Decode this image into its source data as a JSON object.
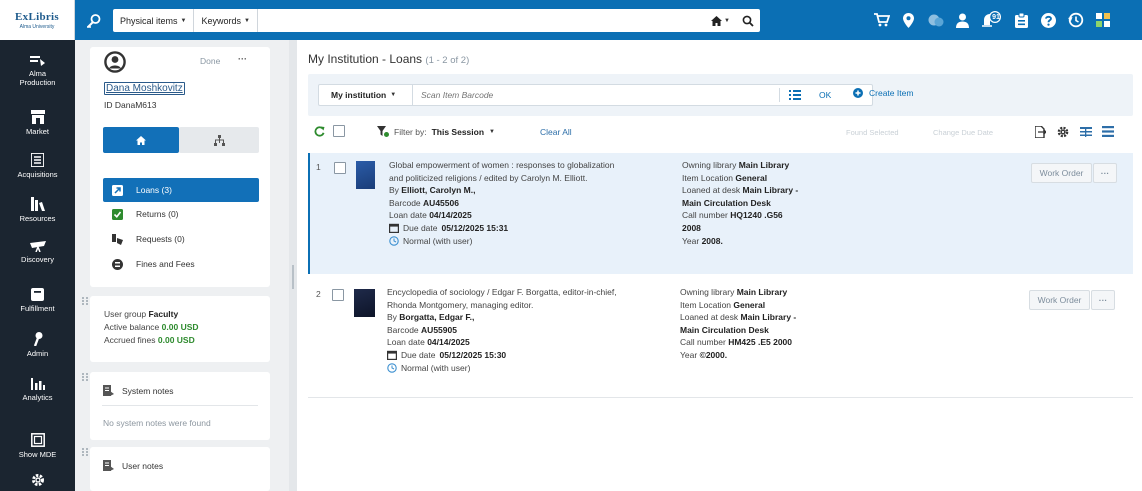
{
  "logo": {
    "line1": "ExLibris",
    "line2": "Alma University"
  },
  "search": {
    "type": "Physical items",
    "field": "Keywords",
    "scope_icon": "home-icon"
  },
  "top_icons": [
    "cart-icon",
    "location-pin-icon",
    "tasks-icon",
    "user-icon",
    "notifications-icon",
    "clipboard-icon",
    "help-icon",
    "history-icon",
    "apps-icon"
  ],
  "notification_count": "91",
  "nav": [
    {
      "label": "Alma\nProduction",
      "icon": "alma-icon"
    },
    {
      "label": "Market",
      "icon": "market-icon"
    },
    {
      "label": "Acquisitions",
      "icon": "acquisitions-icon"
    },
    {
      "label": "Resources",
      "icon": "resources-icon"
    },
    {
      "label": "Discovery",
      "icon": "discovery-icon"
    },
    {
      "label": "Fulfillment",
      "icon": "fulfillment-icon"
    },
    {
      "label": "Admin",
      "icon": "admin-icon"
    },
    {
      "label": "Analytics",
      "icon": "analytics-icon"
    },
    {
      "label": "Show MDE",
      "icon": "mde-icon"
    },
    {
      "label": "",
      "icon": "settings-icon"
    }
  ],
  "user": {
    "done_label": "Done",
    "more": "···",
    "name": "Dana Moshkovitz",
    "id_label": "ID",
    "id_value": "DanaM613",
    "menu": [
      {
        "label": "Loans (3)",
        "icon": "loans-icon",
        "active": true
      },
      {
        "label": "Returns (0)",
        "icon": "returns-icon",
        "active": false
      },
      {
        "label": "Requests (0)",
        "icon": "requests-icon",
        "active": false
      },
      {
        "label": "Fines and Fees",
        "icon": "fines-icon",
        "active": false
      }
    ],
    "group_label": "User group",
    "group_value": "Faculty",
    "balance_label": "Active balance",
    "balance_value": "0.00 USD",
    "accrued_label": "Accrued fines",
    "accrued_value": "0.00 USD",
    "system_notes_title": "System notes",
    "system_notes_empty": "No system notes were found",
    "user_notes_title": "User notes"
  },
  "main": {
    "title": "My Institution - Loans",
    "count": "(1 - 2 of 2)",
    "scope": "My institution",
    "scan_placeholder": "Scan Item Barcode",
    "ok": "OK",
    "create_item": "Create Item",
    "filter_label": "Filter by:",
    "filter_value": "This Session",
    "clear_all": "Clear All",
    "found_selected": "Found Selected",
    "change_due_date": "Change Due Date",
    "colors": {
      "accent": "#0b6fb4",
      "green": "#2e8b2e",
      "selected_row": "#e8f1fa"
    }
  },
  "loans": [
    {
      "index": "1",
      "title_line1": "Global empowerment of women : responses to globalization",
      "title_line2": "and politicized religions / edited by Carolyn M. Elliott.",
      "author_label": "By",
      "author": "Elliott, Carolyn M.,",
      "barcode_label": "Barcode",
      "barcode": "AU45506",
      "loan_label": "Loan date",
      "loan_date": "04/14/2025",
      "due_label": "Due date",
      "due_date": "05/12/2025 15:31",
      "status": "Normal (with user)",
      "owning_label": "Owning library",
      "owning": "Main Library",
      "location_label": "Item Location",
      "location": "General",
      "desk_label": "Loaned at desk",
      "desk_a": "Main Library -",
      "desk_b": "Main Circulation Desk",
      "call_label": "Call number",
      "call_a": "HQ1240 .G56",
      "call_b": "2008",
      "year_label": "Year",
      "year": "2008.",
      "action": "Work Order",
      "more": "···"
    },
    {
      "index": "2",
      "title_line1": "Encyclopedia of sociology / Edgar F. Borgatta, editor-in-chief,",
      "title_line2": "Rhonda Montgomery, managing editor.",
      "author_label": "By",
      "author": "Borgatta, Edgar F.,",
      "barcode_label": "Barcode",
      "barcode": "AU55905",
      "loan_label": "Loan date",
      "loan_date": "04/14/2025",
      "due_label": "Due date",
      "due_date": "05/12/2025 15:30",
      "status": "Normal (with user)",
      "owning_label": "Owning library",
      "owning": "Main Library",
      "location_label": "Item Location",
      "location": "General",
      "desk_label": "Loaned at desk",
      "desk_a": "Main Library -",
      "desk_b": "Main Circulation Desk",
      "call_label": "Call number",
      "call_a": "HM425 .E5 2000",
      "call_b": "",
      "year_label": "Year",
      "year": "©2000.",
      "action": "Work Order",
      "more": "···"
    }
  ]
}
